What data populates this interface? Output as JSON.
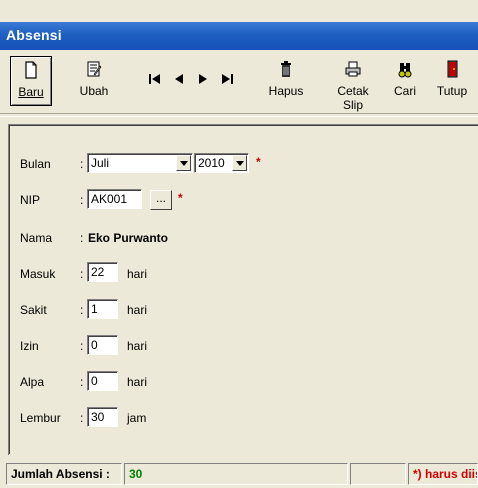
{
  "window": {
    "title": "Absensi"
  },
  "toolbar": {
    "baru": "Baru",
    "ubah": "Ubah",
    "hapus": "Hapus",
    "cetak_slip": "Cetak Slip",
    "cari": "Cari",
    "tutup": "Tutup"
  },
  "form": {
    "bulan": {
      "label": "Bulan",
      "month": "Juli",
      "year": "2010"
    },
    "nip": {
      "label": "NIP",
      "value": "AK001",
      "lookup": "..."
    },
    "nama": {
      "label": "Nama",
      "value": "Eko Purwanto"
    },
    "masuk": {
      "label": "Masuk",
      "value": "22",
      "unit": "hari"
    },
    "sakit": {
      "label": "Sakit",
      "value": "1",
      "unit": "hari"
    },
    "izin": {
      "label": "Izin",
      "value": "0",
      "unit": "hari"
    },
    "alpa": {
      "label": "Alpa",
      "value": "0",
      "unit": "hari"
    },
    "lembur": {
      "label": "Lembur",
      "value": "30",
      "unit": "jam"
    },
    "colon": ":",
    "required_mark": "*"
  },
  "status": {
    "label": "Jumlah Absensi :",
    "value": "30",
    "note": "*) harus diisi"
  },
  "colors": {
    "title_bg": "#1e5fc0",
    "window_bg": "#ece9d8",
    "required": "#d40000",
    "status_value": "#008000"
  }
}
